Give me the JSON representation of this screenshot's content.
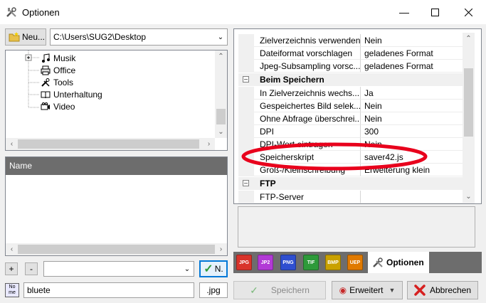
{
  "window": {
    "title": "Optionen"
  },
  "left": {
    "new_button_label": "Neu...",
    "path": "C:\\Users\\SUG2\\Desktop",
    "tree_items": [
      {
        "label": "Musik",
        "icon": "music-note-icon"
      },
      {
        "label": "Office",
        "icon": "printer-icon"
      },
      {
        "label": "Tools",
        "icon": "tools-icon"
      },
      {
        "label": "Unterhaltung",
        "icon": "book-icon"
      },
      {
        "label": "Video",
        "icon": "camera-icon"
      }
    ],
    "file_list_header": "Name",
    "plus_label": "+",
    "minus_label": "-",
    "ok_label": "N.",
    "filename": "bluete",
    "extension": ".jpg"
  },
  "properties": {
    "rows_top": [
      {
        "name": "Zielverzeichnis verwenden",
        "value": "Nein"
      },
      {
        "name": "Dateiformat vorschlagen",
        "value": "geladenes Format"
      },
      {
        "name": "Jpeg-Subsampling vorsc...",
        "value": "geladenes Format"
      }
    ],
    "category_save": "Beim Speichern",
    "rows_save": [
      {
        "name": "In Zielverzeichnis wechs...",
        "value": "Ja"
      },
      {
        "name": "Gespeichertes Bild selek...",
        "value": "Nein"
      },
      {
        "name": "Ohne Abfrage überschrei...",
        "value": "Nein"
      },
      {
        "name": "DPI",
        "value": "300"
      },
      {
        "name": "DPI-Wert eintragen",
        "value": "Nein"
      },
      {
        "name": "Speicherskript",
        "value": "saver42.js"
      },
      {
        "name": "Groß-/Kleinschreibung",
        "value": "Erweiterung klein"
      }
    ],
    "category_ftp": "FTP",
    "rows_ftp": [
      {
        "name": "FTP-Server",
        "value": ""
      }
    ]
  },
  "tabs": [
    {
      "label": "JPG",
      "color": "#d9342b"
    },
    {
      "label": "JP2",
      "color": "#b23ad6"
    },
    {
      "label": "PNG",
      "color": "#2f4fd0"
    },
    {
      "label": "TIF",
      "color": "#2e9a3a"
    },
    {
      "label": "BMP",
      "color": "#c9a100"
    },
    {
      "label": "UEP",
      "color": "#e07a00"
    }
  ],
  "active_tab_label": "Optionen",
  "footer": {
    "save_label": "Speichern",
    "advanced_label": "Erweitert",
    "cancel_label": "Abbrechen"
  },
  "colors": {
    "highlight_ellipse": "#e8001c",
    "list_header": "#6d6d6d"
  }
}
